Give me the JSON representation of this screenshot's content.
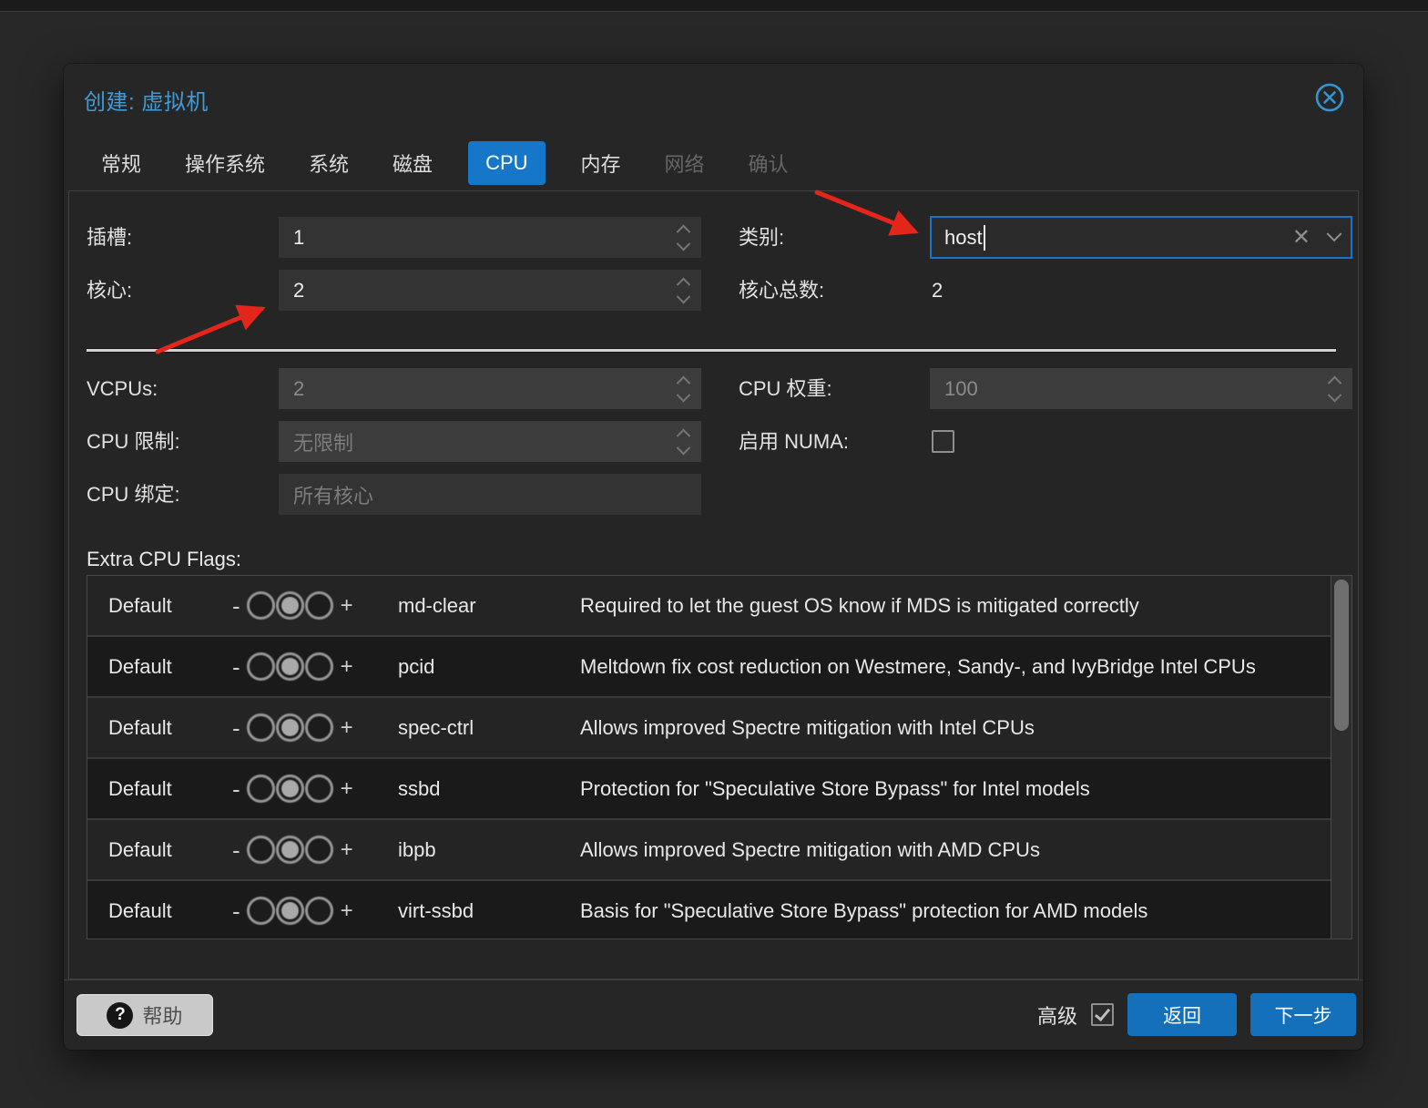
{
  "window": {
    "title": "创建: 虚拟机"
  },
  "tabs": [
    {
      "key": "general",
      "label": "常规",
      "state": "normal"
    },
    {
      "key": "os",
      "label": "操作系统",
      "state": "normal"
    },
    {
      "key": "system",
      "label": "系统",
      "state": "normal"
    },
    {
      "key": "disks",
      "label": "磁盘",
      "state": "normal"
    },
    {
      "key": "cpu",
      "label": "CPU",
      "state": "active"
    },
    {
      "key": "memory",
      "label": "内存",
      "state": "normal"
    },
    {
      "key": "network",
      "label": "网络",
      "state": "disabled"
    },
    {
      "key": "confirm",
      "label": "确认",
      "state": "disabled"
    }
  ],
  "form": {
    "sockets_label": "插槽:",
    "sockets_value": "1",
    "cores_label": "核心:",
    "cores_value": "2",
    "type_label": "类别:",
    "type_value": "host",
    "total_cores_label": "核心总数:",
    "total_cores_value": "2",
    "vcpus_label": "VCPUs:",
    "vcpus_value": "2",
    "cpu_limit_label": "CPU 限制:",
    "cpu_limit_placeholder": "无限制",
    "cpu_weight_label": "CPU 权重:",
    "cpu_weight_value": "100",
    "numa_label": "启用 NUMA:",
    "numa_checked": false,
    "affinity_label": "CPU 绑定:",
    "affinity_placeholder": "所有核心"
  },
  "flags": {
    "section_label": "Extra CPU Flags:",
    "default_label": "Default",
    "minus": "-",
    "plus": "+",
    "rows": [
      {
        "name": "md-clear",
        "description": "Required to let the guest OS know if MDS is mitigated correctly"
      },
      {
        "name": "pcid",
        "description": "Meltdown fix cost reduction on Westmere, Sandy-, and IvyBridge Intel CPUs"
      },
      {
        "name": "spec-ctrl",
        "description": "Allows improved Spectre mitigation with Intel CPUs"
      },
      {
        "name": "ssbd",
        "description": "Protection for \"Speculative Store Bypass\" for Intel models"
      },
      {
        "name": "ibpb",
        "description": "Allows improved Spectre mitigation with AMD CPUs"
      },
      {
        "name": "virt-ssbd",
        "description": "Basis for \"Speculative Store Bypass\" protection for AMD models"
      }
    ]
  },
  "footer": {
    "help_label": "帮助",
    "advanced_label": "高级",
    "advanced_checked": true,
    "back_label": "返回",
    "next_label": "下一步"
  },
  "colors": {
    "accent": "#1676c8",
    "button": "#1470ba",
    "title": "#3e9bd6",
    "arrow": "#e3251b"
  }
}
